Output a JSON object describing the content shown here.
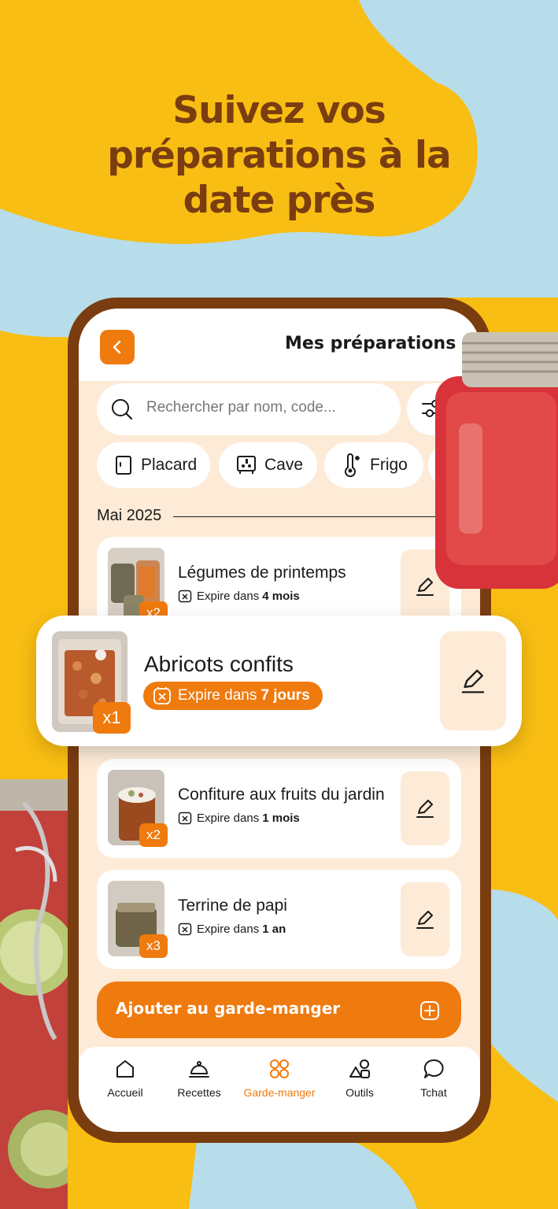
{
  "headline": [
    "Suivez vos",
    "préparations à la",
    "date près"
  ],
  "screen": {
    "title": "Mes préparations",
    "search_placeholder": "Rechercher par nom, code...",
    "chips": [
      "Placard",
      "Cave",
      "Frigo"
    ],
    "month": "Mai 2025"
  },
  "items": [
    {
      "name": "Légumes de printemps",
      "expires_prefix": "Expire dans",
      "expires_value": "4 mois",
      "qty": "x2"
    },
    {
      "name": "Confiture aux fruits du jardin",
      "expires_prefix": "Expire dans",
      "expires_value": "1 mois",
      "qty": "x2"
    },
    {
      "name": "Terrine de papi",
      "expires_prefix": "Expire dans",
      "expires_value": "1 an",
      "qty": "x3"
    }
  ],
  "highlight": {
    "name": "Abricots confits",
    "expires_prefix": "Expire dans",
    "expires_value": "7 jours",
    "qty": "x1"
  },
  "add_button": "Ajouter au garde-manger",
  "nav": [
    {
      "label": "Accueil",
      "icon": "home-icon"
    },
    {
      "label": "Recettes",
      "icon": "cloche-icon"
    },
    {
      "label": "Garde-manger",
      "icon": "grid-icon",
      "active": true
    },
    {
      "label": "Outils",
      "icon": "shapes-icon"
    },
    {
      "label": "Tchat",
      "icon": "chat-icon"
    }
  ],
  "colors": {
    "background": "#F9BE13",
    "blob": "#B7DDEA",
    "accent": "#EF7A0E",
    "brown": "#7A3D10",
    "screen": "#FDEBD7"
  }
}
